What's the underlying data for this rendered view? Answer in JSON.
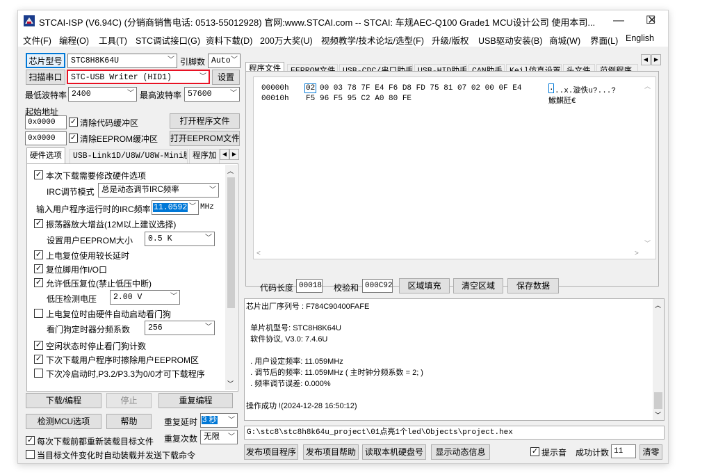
{
  "window": {
    "title": "STCAI-ISP (V6.94C) (分销商销售电话: 0513-55012928) 官网:www.STCAI.com  -- STCAI: 车规AEC-Q100 Grade1 MCU设计公司 使用本司...",
    "minimize": "—",
    "maximize": "☐",
    "close": "✕"
  },
  "menu": [
    "文件(F)",
    "编程(O)",
    "工具(T)",
    "STC调试接口(G)",
    "资料下载(D)",
    "200万大奖(U)",
    "视频教学/技术论坛/选型(F)",
    "升级/版权",
    "USB驱动安装(B)",
    "商城(W)",
    "界面(L)",
    "English"
  ],
  "left": {
    "chip_type_label": "芯片型号",
    "chip_type_value": "STC8H8K64U",
    "pin_count_label": "引脚数",
    "pin_count_value": "Auto",
    "scan_port_label": "扫描串口",
    "port_value": "STC-USB Writer (HID1)",
    "settings_label": "设置",
    "min_baud_label": "最低波特率",
    "min_baud_value": "2400",
    "max_baud_label": "最高波特率",
    "max_baud_value": "57600",
    "start_addr_label": "起始地址",
    "code_addr": "0x0000",
    "clear_code_label": "清除代码缓冲区",
    "open_program_label": "打开程序文件",
    "eeprom_addr": "0x0000",
    "clear_eeprom_label": "清除EEPROM缓冲区",
    "open_eeprom_label": "打开EEPROM文件",
    "tabs": [
      "硬件选项",
      "USB-Link1D/U8W/U8W-Mini脱机",
      "程序加"
    ],
    "hw": {
      "modify_hw": "本次下载需要修改硬件选项",
      "irc_mode_label": "IRC调节模式",
      "irc_mode_value": "总是动态调节IRC频率",
      "irc_freq_label": "输入用户程序运行时的IRC频率",
      "irc_freq_value": "11.0592",
      "irc_freq_unit": "MHz",
      "osc_gain": "振荡器放大增益(12M以上建议选择)",
      "eeprom_size_label": "设置用户EEPROM大小",
      "eeprom_size_value": "0.5 K",
      "long_reset_delay": "上电复位使用较长延时",
      "reset_pin_io": "复位脚用作I/O口",
      "low_volt_reset": "允许低压复位(禁止低压中断)",
      "low_volt_label": "低压检测电压",
      "low_volt_value": "2.00 V",
      "hw_watchdog": "上电复位时由硬件自动启动看门狗",
      "wdt_div_label": "看门狗定时器分频系数",
      "wdt_div_value": "256",
      "idle_stop_wdt": "空闲状态时停止看门狗计数",
      "erase_eeprom": "下次下载用户程序时擦除用户EEPROM区",
      "p32_p33": "下次冷启动时,P3.2/P3.3为0/0才可下载程序"
    },
    "download_label": "下载/编程",
    "stop_label": "停止",
    "reprogram_label": "重复编程",
    "detect_label": "检测MCU选项",
    "help_label": "帮助",
    "repeat_delay_label": "重复延时",
    "repeat_delay_value": "3 秒",
    "reload_each_label": "每次下载前都重新装载目标文件",
    "repeat_count_label": "重复次数",
    "repeat_count_value": "无限",
    "auto_reload_label": "当目标文件变化时自动装载并发送下载命令"
  },
  "right": {
    "tabs": [
      "程序文件",
      "EEPROM文件",
      "USB-CDC/串口助手",
      "USB-HID助手",
      "CAN助手",
      "Keil仿真设置",
      "头文件",
      "范例程序"
    ],
    "hex": {
      "rows": [
        {
          "addr": "00000h",
          "first": "02",
          "rest": "00 03 78 7F E4 F6 D8 FD 75 81 07 02 00 0F E4",
          "cursor": ".",
          "ascii": "..x.漩佚u?...?"
        },
        {
          "addr": "00010h",
          "first": "F5",
          "rest": "96 F5 95 C2 A0 80 FE",
          "cursor": "",
          "ascii": "鯸鯕瓩€"
        }
      ]
    },
    "code_len_label": "代码长度",
    "code_len_value": "00018",
    "checksum_label": "校验和",
    "checksum_value": "000C92",
    "fill_label": "区域填充",
    "clear_area_label": "清空区域",
    "save_label": "保存数据",
    "log": [
      "芯片出厂序列号 : F784C90400FAFE",
      "",
      "  单片机型号: STC8H8K64U",
      "  软件协议, V3.0: 7.4.6U",
      "",
      "  . 用户设定频率: 11.059MHz",
      "  . 调节后的频率: 11.059MHz ( 主时钟分频系数 = 2; )",
      "  . 频率调节误差: 0.000%",
      "",
      "操作成功 !(2024-12-28 16:50:12)"
    ],
    "path": "G:\\stc8\\stc8h8k64u_project\\01点亮1个led\\Objects\\project.hex",
    "publish_program_label": "发布项目程序",
    "publish_help_label": "发布项目帮助",
    "read_disk_label": "读取本机硬盘号",
    "show_dynamic_label": "显示动态信息",
    "beep_label": "提示音",
    "success_count_label": "成功计数",
    "success_count_value": "11",
    "clear_label": "清零"
  },
  "colors": {
    "accent": "#0078d7",
    "highlight_border": "#e81123",
    "window_bg": "#f0f0f0"
  },
  "icons": {
    "app": "stc-logo-icon"
  }
}
